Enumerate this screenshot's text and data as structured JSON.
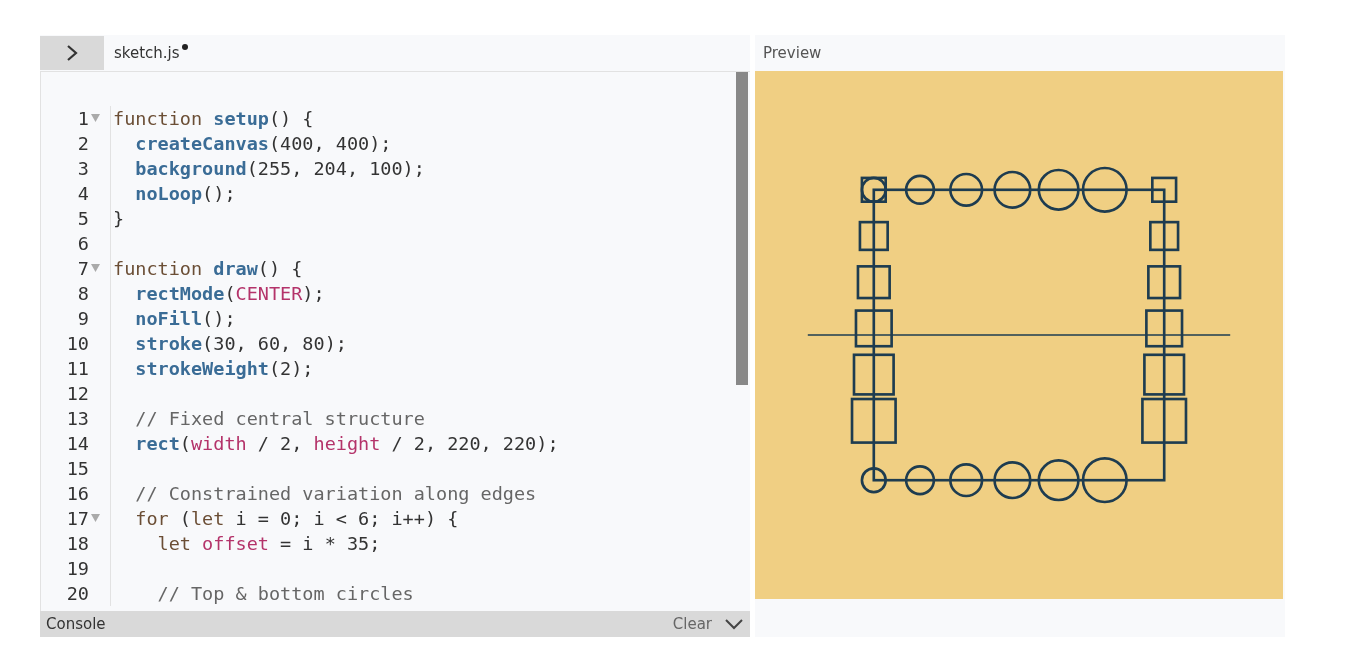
{
  "editor": {
    "tab": {
      "label": "sketch.js",
      "unsaved": true
    },
    "lines": [
      {
        "number": "1",
        "fold": true,
        "tokens": [
          {
            "kind": "kw",
            "text": "function "
          },
          {
            "kind": "fn",
            "text": "setup"
          },
          {
            "kind": "plain",
            "text": "() {"
          }
        ]
      },
      {
        "number": "2",
        "fold": false,
        "tokens": [
          {
            "kind": "fn",
            "text": "  createCanvas"
          },
          {
            "kind": "plain",
            "text": "(400, 400);"
          }
        ]
      },
      {
        "number": "3",
        "fold": false,
        "tokens": [
          {
            "kind": "fn",
            "text": "  background"
          },
          {
            "kind": "plain",
            "text": "(255, 204, 100);"
          }
        ]
      },
      {
        "number": "4",
        "fold": false,
        "tokens": [
          {
            "kind": "fn",
            "text": "  noLoop"
          },
          {
            "kind": "plain",
            "text": "();"
          }
        ]
      },
      {
        "number": "5",
        "fold": false,
        "tokens": [
          {
            "kind": "plain",
            "text": "}"
          }
        ]
      },
      {
        "number": "6",
        "fold": false
      },
      {
        "number": "7",
        "fold": true,
        "tokens": [
          {
            "kind": "kw",
            "text": "function "
          },
          {
            "kind": "fn",
            "text": "draw"
          },
          {
            "kind": "plain",
            "text": "() {"
          }
        ]
      },
      {
        "number": "8",
        "fold": false,
        "tokens": [
          {
            "kind": "fn",
            "text": "  rectMode"
          },
          {
            "kind": "plain",
            "text": "("
          },
          {
            "kind": "const",
            "text": "CENTER"
          },
          {
            "kind": "plain",
            "text": ");"
          }
        ]
      },
      {
        "number": "9",
        "fold": false,
        "tokens": [
          {
            "kind": "fn",
            "text": "  noFill"
          },
          {
            "kind": "plain",
            "text": "();"
          }
        ]
      },
      {
        "number": "10",
        "fold": false,
        "tokens": [
          {
            "kind": "fn",
            "text": "  stroke"
          },
          {
            "kind": "plain",
            "text": "(30, 60, 80);"
          }
        ]
      },
      {
        "number": "11",
        "fold": false,
        "tokens": [
          {
            "kind": "fn",
            "text": "  strokeWeight"
          },
          {
            "kind": "plain",
            "text": "(2);"
          }
        ]
      },
      {
        "number": "12",
        "fold": false
      },
      {
        "number": "13",
        "fold": false,
        "tokens": [
          {
            "kind": "comment",
            "text": "  // Fixed central structure"
          }
        ]
      },
      {
        "number": "14",
        "fold": false,
        "tokens": [
          {
            "kind": "fn",
            "text": "  rect"
          },
          {
            "kind": "plain",
            "text": "("
          },
          {
            "kind": "const",
            "text": "width"
          },
          {
            "kind": "plain",
            "text": " / 2, "
          },
          {
            "kind": "const",
            "text": "height"
          },
          {
            "kind": "plain",
            "text": " / 2, 220, 220);"
          }
        ]
      },
      {
        "number": "15",
        "fold": false
      },
      {
        "number": "16",
        "fold": false,
        "tokens": [
          {
            "kind": "comment",
            "text": "  // Constrained variation along edges"
          }
        ]
      },
      {
        "number": "17",
        "fold": true,
        "tokens": [
          {
            "kind": "kw",
            "text": "  for"
          },
          {
            "kind": "plain",
            "text": " ("
          },
          {
            "kind": "kw",
            "text": "let"
          },
          {
            "kind": "plain",
            "text": " i = 0; i < 6; i++) {"
          }
        ]
      },
      {
        "number": "18",
        "fold": false,
        "tokens": [
          {
            "kind": "kw",
            "text": "    let "
          },
          {
            "kind": "const",
            "text": "offset"
          },
          {
            "kind": "plain",
            "text": " = i * 35;"
          }
        ]
      },
      {
        "number": "19",
        "fold": false
      },
      {
        "number": "20",
        "fold": false,
        "tokens": [
          {
            "kind": "comment",
            "text": "    // Top & bottom circles"
          }
        ]
      }
    ]
  },
  "console": {
    "title": "Console",
    "clear": "Clear"
  },
  "preview": {
    "title": "Preview"
  }
}
